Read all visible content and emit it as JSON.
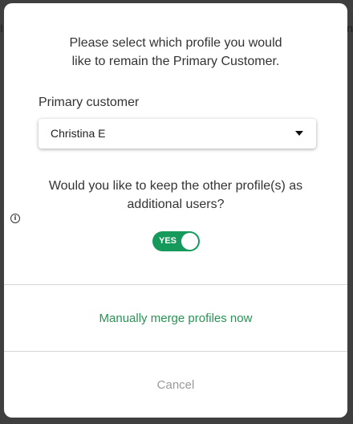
{
  "backdrop": {
    "left_text": "I",
    "right_text": "n"
  },
  "dialog": {
    "prompt_line1": "Please select which profile you would",
    "prompt_line2": "like to remain the Primary Customer.",
    "primary_label": "Primary customer",
    "primary_select": {
      "value": "Christina E",
      "icon": "caret-down-icon"
    },
    "question_line1": "Would you like to keep the other profile(s) as",
    "question_line2": "additional users?",
    "info_icon_glyph": "i",
    "toggle": {
      "label": "YES",
      "on": true
    },
    "merge_link": "Manually merge profiles now",
    "cancel": "Cancel"
  },
  "colors": {
    "accent_green": "#159a5c",
    "link_green": "#2a9254",
    "cancel_gray": "#9a9a9a",
    "overlay": "#3f3f3f"
  }
}
